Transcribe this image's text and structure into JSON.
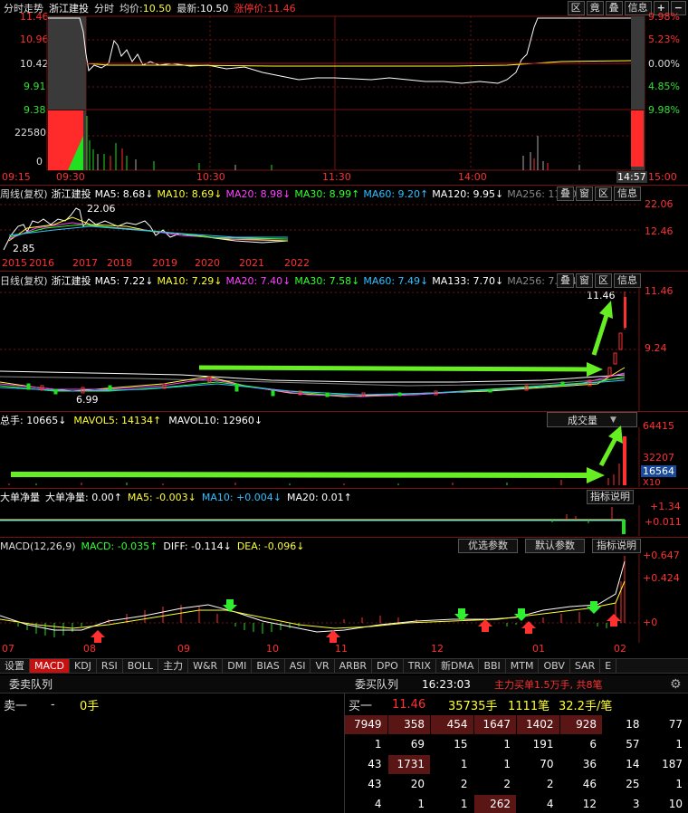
{
  "colors": {
    "up": "#ff3030",
    "down": "#20e020",
    "price_line": "#ffffff",
    "avg_line": "#ffff30",
    "arrow": "#66ee22",
    "grid_red": "#7a1010"
  },
  "intraday": {
    "title": "分时走势",
    "stock": "浙江建投",
    "mode": "分时",
    "avg_label": "均价:",
    "avg_value": "10.50",
    "last_label": "最新:",
    "last_value": "10.50",
    "limit_label": "涨停价:",
    "limit_value": "11.46",
    "buttons": [
      "区",
      "竟",
      "叠",
      "信息",
      "+",
      "−"
    ],
    "price_ticks": [
      "11.46",
      "10.96",
      "10.42",
      "9.91",
      "9.38"
    ],
    "pct_ticks": [
      "9.98%",
      "5.23%",
      "0.00%",
      "4.85%",
      "9.98%"
    ],
    "vol_ticks": [
      "22580",
      "0"
    ],
    "time_ticks": [
      "09:15",
      "09:30",
      "10:30",
      "11:30",
      "14:00",
      "14:57",
      "15:00"
    ]
  },
  "weekly": {
    "title": "周线(复权)",
    "stock": "浙江建投",
    "ma": [
      {
        "label": "MA5: 8.68↓",
        "color": "#ffffff"
      },
      {
        "label": "MA10: 8.69↓",
        "color": "#ffff30"
      },
      {
        "label": "MA20: 8.98↓",
        "color": "#ff40ff"
      },
      {
        "label": "MA30: 8.99↑",
        "color": "#30ff30"
      },
      {
        "label": "MA60: 9.20↑",
        "color": "#30c0ff"
      },
      {
        "label": "MA120: 9.95↓",
        "color": "#ffffff"
      },
      {
        "label": "MA256: 11.50↓",
        "color": "#888888"
      }
    ],
    "buttons": [
      "叠",
      "窗",
      "区",
      "信息"
    ],
    "high_label": "22.06",
    "low_label": "2.85",
    "axis_right": [
      "22.06",
      "12.46"
    ],
    "years": [
      "2015",
      "2016",
      "2017",
      "2018",
      "2019",
      "2020",
      "2021",
      "2022"
    ]
  },
  "daily": {
    "title": "日线(复权)",
    "stock": "浙江建投",
    "ma": [
      {
        "label": "MA5: 7.22↓",
        "color": "#ffffff"
      },
      {
        "label": "MA10: 7.29↓",
        "color": "#ffff30"
      },
      {
        "label": "MA20: 7.40↓",
        "color": "#ff40ff"
      },
      {
        "label": "MA30: 7.58↓",
        "color": "#30ff30"
      },
      {
        "label": "MA60: 7.49↓",
        "color": "#30c0ff"
      },
      {
        "label": "MA133: 7.70↓",
        "color": "#ffffff"
      },
      {
        "label": "MA256: 7.92↓",
        "color": "#888888"
      }
    ],
    "buttons": [
      "叠",
      "窗",
      "区",
      "信息"
    ],
    "high_label": "11.46",
    "low_label": "6.99",
    "axis_right": [
      "11.46",
      "9.24"
    ]
  },
  "volume": {
    "total": "总手: 10665↓",
    "mavol5": "MAVOL5: 14134↑",
    "mavol10": "MAVOL10: 12960↓",
    "select": "成交量",
    "axis_right": [
      "64415",
      "32207",
      "16564",
      "X10"
    ]
  },
  "bigorder": {
    "title": "大单净量",
    "value": "大单净量: 0.00↑",
    "ma5": "MA5: -0.003↓",
    "ma10": "MA10: +0.004↓",
    "ma20": "MA20: 0.01↑",
    "button": "指标说明",
    "axis_right": [
      "+1.34",
      "+0.011"
    ]
  },
  "macd": {
    "title": "MACD(12,26,9)",
    "macd": "MACD: -0.035↑",
    "diff": "DIFF: -0.114↓",
    "dea": "DEA: -0.096↓",
    "buttons": [
      "优选参数",
      "默认参数",
      "指标说明"
    ],
    "axis_right": [
      "+0.647",
      "+0.424",
      "+0"
    ],
    "months": [
      "07",
      "08",
      "09",
      "10",
      "11",
      "12",
      "01",
      "02"
    ]
  },
  "tabs": [
    "设置",
    "MACD",
    "KDJ",
    "RSI",
    "BOLL",
    "主力",
    "W&R",
    "DMI",
    "BIAS",
    "ASI",
    "VR",
    "ARBR",
    "DPO",
    "TRIX",
    "新DMA",
    "BBI",
    "MTM",
    "OBV",
    "SAR",
    "E"
  ],
  "active_tab": "MACD",
  "orderbook": {
    "left_title": "委卖队列",
    "right_title": "委买队列",
    "time": "16:23:03",
    "summary": "主力买单1.5万手, 共8笔",
    "sell1_label": "卖一",
    "sell1_price": "-",
    "sell1_qty": "0手",
    "buy1_label": "买一",
    "buy1_price": "11.46",
    "buy1_qty": "35735手",
    "buy1_count": "1111笔",
    "buy1_avg": "32.2手/笔",
    "rows": [
      [
        "7949",
        "358",
        "454",
        "1647",
        "1402",
        "928",
        "18",
        "77"
      ],
      [
        "1",
        "69",
        "15",
        "1",
        "191",
        "6",
        "57",
        "1"
      ],
      [
        "43",
        "1731",
        "1",
        "1",
        "70",
        "36",
        "14",
        "187"
      ],
      [
        "43",
        "20",
        "2",
        "2",
        "2",
        "46",
        "25",
        "1"
      ],
      [
        "4",
        "1",
        "1",
        "262",
        "4",
        "12",
        "3",
        "10"
      ]
    ],
    "hot": [
      [
        0,
        0
      ],
      [
        0,
        1
      ],
      [
        0,
        2
      ],
      [
        0,
        3
      ],
      [
        0,
        4
      ],
      [
        0,
        5
      ],
      [
        2,
        1
      ],
      [
        4,
        3
      ]
    ]
  }
}
